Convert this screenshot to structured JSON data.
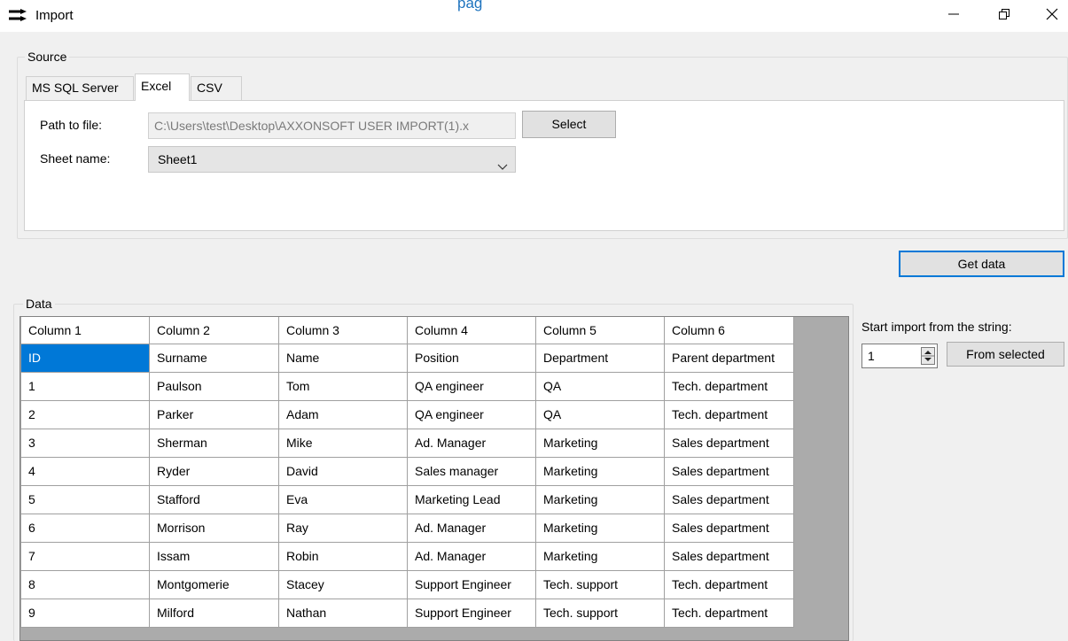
{
  "window": {
    "title": "Import",
    "top_link_fragment": "pag"
  },
  "source": {
    "group_label": "Source",
    "tabs": [
      "MS SQL Server",
      "Excel",
      "CSV"
    ],
    "active_tab": "Excel",
    "path_label": "Path to file:",
    "path_value": "C:\\Users\\test\\Desktop\\AXXONSOFT USER IMPORT(1).x",
    "select_button": "Select",
    "sheet_label": "Sheet name:",
    "sheet_value": "Sheet1"
  },
  "get_data_button": "Get data",
  "data": {
    "group_label": "Data",
    "columns": [
      "Column 1",
      "Column 2",
      "Column 3",
      "Column 4",
      "Column 5",
      "Column 6"
    ],
    "rows": [
      [
        "ID",
        "Surname",
        "Name",
        "Position",
        "Department",
        "Parent department"
      ],
      [
        "1",
        "Paulson",
        "Tom",
        "QA engineer",
        "QA",
        "Tech. department"
      ],
      [
        "2",
        "Parker",
        "Adam",
        "QA engineer",
        "QA",
        "Tech. department"
      ],
      [
        "3",
        "Sherman",
        "Mike",
        "Ad. Manager",
        "Marketing",
        "Sales department"
      ],
      [
        "4",
        "Ryder",
        "David",
        "Sales manager",
        "Marketing",
        "Sales department"
      ],
      [
        "5",
        "Stafford",
        "Eva",
        "Marketing Lead",
        "Marketing",
        "Sales department"
      ],
      [
        "6",
        "Morrison",
        "Ray",
        "Ad. Manager",
        "Marketing",
        "Sales department"
      ],
      [
        "7",
        "Issam",
        "Robin",
        "Ad. Manager",
        "Marketing",
        "Sales department"
      ],
      [
        "8",
        "Montgomerie",
        "Stacey",
        "Support Engineer",
        "Tech. support",
        "Tech. department"
      ],
      [
        "9",
        "Milford",
        "Nathan",
        "Support Engineer",
        "Tech. support",
        "Tech. department"
      ]
    ]
  },
  "start_import": {
    "label": "Start import from the string:",
    "value": "1",
    "from_selected_button": "From selected"
  },
  "colors": {
    "selection": "#0078d7",
    "grid_background": "#ababab",
    "link": "#1e73be"
  },
  "icons": [
    "import-arrows-icon",
    "minimize-icon",
    "restore-icon",
    "close-icon",
    "chevron-down-icon",
    "spin-arrows-icon"
  ]
}
